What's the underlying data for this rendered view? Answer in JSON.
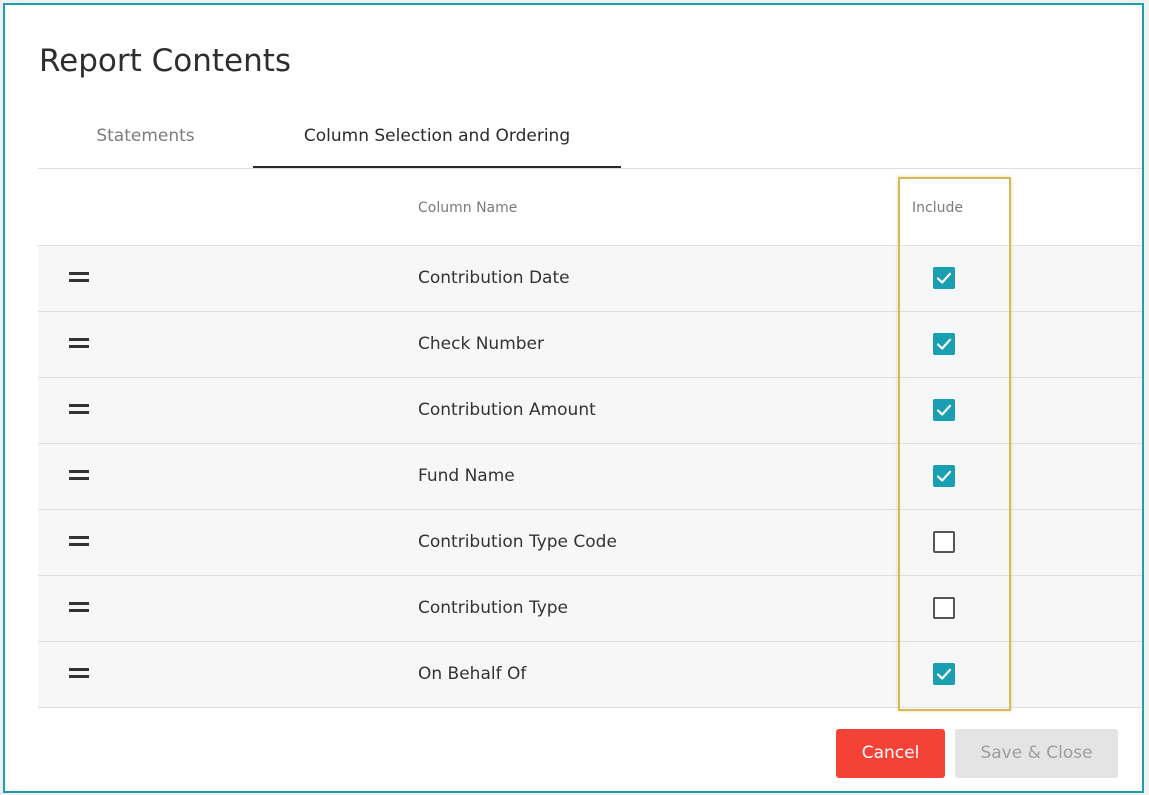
{
  "dialog": {
    "title": "Report Contents",
    "tabs": [
      {
        "label": "Statements",
        "active": false
      },
      {
        "label": "Column Selection and Ordering",
        "active": true
      }
    ],
    "table": {
      "headers": {
        "column_name": "Column Name",
        "include": "Include"
      },
      "rows": [
        {
          "name": "Contribution Date",
          "include": true
        },
        {
          "name": "Check Number",
          "include": true
        },
        {
          "name": "Contribution Amount",
          "include": true
        },
        {
          "name": "Fund Name",
          "include": true
        },
        {
          "name": "Contribution Type Code",
          "include": false
        },
        {
          "name": "Contribution Type",
          "include": false
        },
        {
          "name": "On Behalf Of",
          "include": true
        }
      ]
    },
    "buttons": {
      "cancel": "Cancel",
      "save_close": "Save & Close"
    }
  },
  "colors": {
    "accent": "#1a9fb2",
    "cancel": "#f44336",
    "highlight": "#d8b95a",
    "disabled": "#e4e4e4"
  },
  "icons": {
    "drag_handle": "drag-handle-icon",
    "check": "checkmark-icon"
  }
}
